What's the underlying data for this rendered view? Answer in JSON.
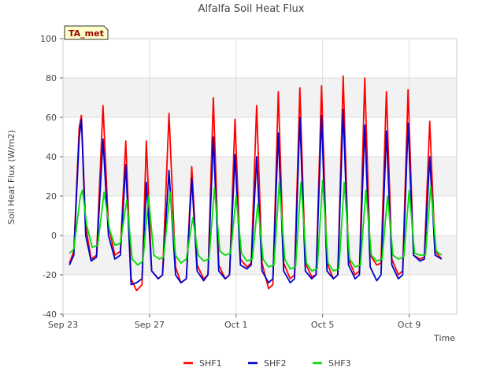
{
  "chart_data": {
    "type": "line",
    "title": "Alfalfa Soil Heat Flux",
    "xlabel": "Time",
    "ylabel": "Soil Heat Flux (W/m2)",
    "ylim": [
      -40,
      100
    ],
    "xlim_days": [
      0,
      18.2
    ],
    "y_ticks": [
      -40,
      -20,
      0,
      20,
      40,
      60,
      80,
      100
    ],
    "x_ticks": [
      {
        "day": 0,
        "label": "Sep 23"
      },
      {
        "day": 4,
        "label": "Sep 27"
      },
      {
        "day": 8,
        "label": "Oct 1"
      },
      {
        "day": 12,
        "label": "Oct 5"
      },
      {
        "day": 16,
        "label": "Oct 9"
      }
    ],
    "badge": "TA_met",
    "grid": true,
    "legend_position": "bottom",
    "series": [
      {
        "name": "SHF1",
        "color": "#ff0000",
        "peaks": [
          61,
          66,
          48,
          50,
          62,
          35,
          70,
          59,
          66,
          73,
          75,
          76,
          81,
          80,
          73,
          74,
          58
        ],
        "troughs": [
          -15,
          -13,
          -10,
          -28,
          -22,
          -24,
          -22,
          -16,
          -16,
          -27,
          -22,
          -21,
          -22,
          -20,
          -15,
          -20,
          -12
        ],
        "points": [
          [
            0.3,
            -14
          ],
          [
            0.5,
            -8
          ],
          [
            0.75,
            55
          ],
          [
            0.85,
            61
          ],
          [
            1.05,
            5
          ],
          [
            1.3,
            -12
          ],
          [
            1.55,
            -10
          ],
          [
            1.85,
            66
          ],
          [
            2.1,
            5
          ],
          [
            2.4,
            -10
          ],
          [
            2.65,
            -8
          ],
          [
            2.9,
            48
          ],
          [
            3.15,
            -22
          ],
          [
            3.4,
            -28
          ],
          [
            3.65,
            -25
          ],
          [
            3.85,
            48
          ],
          [
            4.1,
            -18
          ],
          [
            4.4,
            -22
          ],
          [
            4.6,
            -20
          ],
          [
            4.9,
            62
          ],
          [
            5.2,
            -16
          ],
          [
            5.45,
            -24
          ],
          [
            5.7,
            -22
          ],
          [
            5.95,
            35
          ],
          [
            6.2,
            -15
          ],
          [
            6.5,
            -22
          ],
          [
            6.7,
            -20
          ],
          [
            6.95,
            70
          ],
          [
            7.2,
            -15
          ],
          [
            7.5,
            -22
          ],
          [
            7.7,
            -20
          ],
          [
            7.95,
            59
          ],
          [
            8.2,
            -12
          ],
          [
            8.5,
            -16
          ],
          [
            8.7,
            -14
          ],
          [
            8.95,
            66
          ],
          [
            9.2,
            -14
          ],
          [
            9.5,
            -27
          ],
          [
            9.7,
            -25
          ],
          [
            9.95,
            73
          ],
          [
            10.2,
            -14
          ],
          [
            10.5,
            -22
          ],
          [
            10.7,
            -20
          ],
          [
            10.95,
            75
          ],
          [
            11.2,
            -14
          ],
          [
            11.5,
            -21
          ],
          [
            11.7,
            -20
          ],
          [
            11.95,
            76
          ],
          [
            12.2,
            -14
          ],
          [
            12.5,
            -22
          ],
          [
            12.7,
            -20
          ],
          [
            12.95,
            81
          ],
          [
            13.2,
            -12
          ],
          [
            13.5,
            -20
          ],
          [
            13.7,
            -18
          ],
          [
            13.95,
            80
          ],
          [
            14.2,
            -10
          ],
          [
            14.5,
            -15
          ],
          [
            14.7,
            -14
          ],
          [
            14.95,
            73
          ],
          [
            15.2,
            -12
          ],
          [
            15.5,
            -20
          ],
          [
            15.7,
            -18
          ],
          [
            15.95,
            74
          ],
          [
            16.2,
            -10
          ],
          [
            16.5,
            -12
          ],
          [
            16.7,
            -11
          ],
          [
            16.95,
            58
          ],
          [
            17.2,
            -8
          ],
          [
            17.5,
            -12
          ]
        ]
      },
      {
        "name": "SHF2",
        "color": "#0000cc",
        "peaks": [
          59,
          49,
          36,
          27,
          33,
          29,
          50,
          41,
          40,
          52,
          60,
          61,
          64,
          56,
          53,
          57,
          40
        ],
        "troughs": [
          -16,
          -13,
          -25,
          -24,
          -22,
          -24,
          -23,
          -17,
          -20,
          -24,
          -24,
          -22,
          -22,
          -22,
          -23,
          -22,
          -13
        ],
        "points": [
          [
            0.3,
            -15
          ],
          [
            0.5,
            -10
          ],
          [
            0.75,
            50
          ],
          [
            0.85,
            59
          ],
          [
            1.05,
            0
          ],
          [
            1.3,
            -13
          ],
          [
            1.55,
            -11
          ],
          [
            1.85,
            49
          ],
          [
            2.1,
            0
          ],
          [
            2.4,
            -12
          ],
          [
            2.65,
            -10
          ],
          [
            2.9,
            36
          ],
          [
            3.15,
            -25
          ],
          [
            3.4,
            -24
          ],
          [
            3.65,
            -22
          ],
          [
            3.85,
            27
          ],
          [
            4.1,
            -18
          ],
          [
            4.4,
            -22
          ],
          [
            4.6,
            -20
          ],
          [
            4.9,
            33
          ],
          [
            5.2,
            -20
          ],
          [
            5.45,
            -24
          ],
          [
            5.7,
            -22
          ],
          [
            5.95,
            29
          ],
          [
            6.2,
            -18
          ],
          [
            6.5,
            -23
          ],
          [
            6.7,
            -20
          ],
          [
            6.95,
            50
          ],
          [
            7.2,
            -18
          ],
          [
            7.5,
            -22
          ],
          [
            7.7,
            -20
          ],
          [
            7.95,
            41
          ],
          [
            8.2,
            -15
          ],
          [
            8.5,
            -17
          ],
          [
            8.7,
            -15
          ],
          [
            8.95,
            40
          ],
          [
            9.2,
            -18
          ],
          [
            9.5,
            -24
          ],
          [
            9.7,
            -22
          ],
          [
            9.95,
            52
          ],
          [
            10.2,
            -18
          ],
          [
            10.5,
            -24
          ],
          [
            10.7,
            -22
          ],
          [
            10.95,
            60
          ],
          [
            11.2,
            -18
          ],
          [
            11.5,
            -22
          ],
          [
            11.7,
            -20
          ],
          [
            11.95,
            61
          ],
          [
            12.2,
            -18
          ],
          [
            12.5,
            -22
          ],
          [
            12.7,
            -20
          ],
          [
            12.95,
            64
          ],
          [
            13.2,
            -15
          ],
          [
            13.5,
            -22
          ],
          [
            13.7,
            -20
          ],
          [
            13.95,
            56
          ],
          [
            14.2,
            -16
          ],
          [
            14.5,
            -23
          ],
          [
            14.7,
            -20
          ],
          [
            14.95,
            53
          ],
          [
            15.2,
            -15
          ],
          [
            15.5,
            -22
          ],
          [
            15.7,
            -20
          ],
          [
            15.95,
            57
          ],
          [
            16.2,
            -10
          ],
          [
            16.5,
            -13
          ],
          [
            16.7,
            -12
          ],
          [
            16.95,
            40
          ],
          [
            17.2,
            -10
          ],
          [
            17.5,
            -12
          ]
        ]
      },
      {
        "name": "SHF3",
        "color": "#00e000",
        "peaks": [
          23,
          22,
          18,
          20,
          22,
          9,
          24,
          20,
          16,
          27,
          27,
          28,
          27,
          23,
          20,
          23,
          25
        ],
        "troughs": [
          -10,
          -6,
          -5,
          -15,
          -12,
          -14,
          -13,
          -10,
          -13,
          -16,
          -17,
          -18,
          -18,
          -16,
          -13,
          -12,
          -10
        ],
        "points": [
          [
            0.3,
            -9
          ],
          [
            0.5,
            -7
          ],
          [
            0.8,
            20
          ],
          [
            0.9,
            23
          ],
          [
            1.1,
            5
          ],
          [
            1.35,
            -6
          ],
          [
            1.6,
            -5
          ],
          [
            1.9,
            22
          ],
          [
            2.15,
            3
          ],
          [
            2.4,
            -5
          ],
          [
            2.65,
            -4
          ],
          [
            2.95,
            18
          ],
          [
            3.2,
            -12
          ],
          [
            3.45,
            -15
          ],
          [
            3.7,
            -13
          ],
          [
            3.95,
            20
          ],
          [
            4.2,
            -10
          ],
          [
            4.45,
            -12
          ],
          [
            4.65,
            -11
          ],
          [
            4.95,
            22
          ],
          [
            5.2,
            -10
          ],
          [
            5.45,
            -14
          ],
          [
            5.7,
            -12
          ],
          [
            6.0,
            9
          ],
          [
            6.25,
            -10
          ],
          [
            6.5,
            -13
          ],
          [
            6.75,
            -12
          ],
          [
            7.0,
            24
          ],
          [
            7.25,
            -8
          ],
          [
            7.5,
            -10
          ],
          [
            7.75,
            -9
          ],
          [
            8.0,
            20
          ],
          [
            8.25,
            -9
          ],
          [
            8.5,
            -13
          ],
          [
            8.75,
            -12
          ],
          [
            9.0,
            16
          ],
          [
            9.25,
            -12
          ],
          [
            9.5,
            -16
          ],
          [
            9.75,
            -15
          ],
          [
            10.0,
            27
          ],
          [
            10.25,
            -12
          ],
          [
            10.5,
            -17
          ],
          [
            10.75,
            -16
          ],
          [
            11.0,
            27
          ],
          [
            11.25,
            -14
          ],
          [
            11.5,
            -18
          ],
          [
            11.75,
            -17
          ],
          [
            12.0,
            28
          ],
          [
            12.25,
            -14
          ],
          [
            12.5,
            -18
          ],
          [
            12.75,
            -17
          ],
          [
            13.0,
            27
          ],
          [
            13.25,
            -12
          ],
          [
            13.5,
            -16
          ],
          [
            13.75,
            -15
          ],
          [
            14.0,
            23
          ],
          [
            14.25,
            -10
          ],
          [
            14.5,
            -13
          ],
          [
            14.75,
            -12
          ],
          [
            15.0,
            20
          ],
          [
            15.25,
            -10
          ],
          [
            15.5,
            -12
          ],
          [
            15.75,
            -11
          ],
          [
            16.0,
            23
          ],
          [
            16.25,
            -9
          ],
          [
            16.5,
            -10
          ],
          [
            16.75,
            -10
          ],
          [
            17.0,
            25
          ],
          [
            17.25,
            -8
          ],
          [
            17.5,
            -10
          ]
        ]
      }
    ]
  }
}
